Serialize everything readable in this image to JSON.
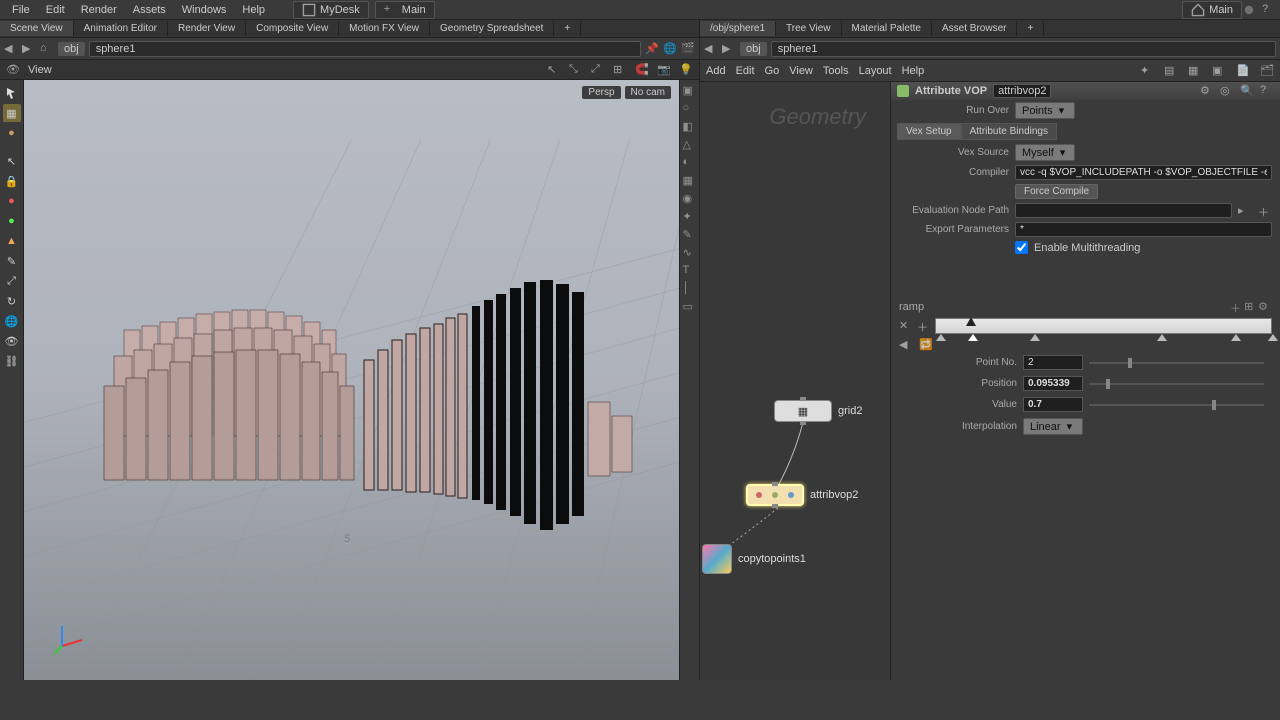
{
  "menu": {
    "items": [
      "File",
      "Edit",
      "Render",
      "Assets",
      "Windows",
      "Help"
    ],
    "desk": "MyDesk",
    "main": "Main",
    "right_main": "Main"
  },
  "left_tabs": [
    "Scene View",
    "Animation Editor",
    "Render View",
    "Composite View",
    "Motion FX View",
    "Geometry Spreadsheet",
    "+"
  ],
  "right_tabs": [
    "/obj/sphere1",
    "Tree View",
    "Material Palette",
    "Asset Browser",
    "+"
  ],
  "path": {
    "left_crumbs": [
      "obj",
      "sphere1"
    ],
    "right_crumbs": [
      "obj",
      "sphere1"
    ]
  },
  "view": {
    "label": "View",
    "cam": [
      "Persp",
      "No cam"
    ]
  },
  "network_menu": [
    "Add",
    "Edit",
    "Go",
    "View",
    "Tools",
    "Layout",
    "Help"
  ],
  "geo_label": "Geometry",
  "nodes": {
    "grid2": {
      "label": "grid2"
    },
    "attribvop2": {
      "label": "attribvop2"
    },
    "copytopoints1": {
      "label": "copytopoints1"
    }
  },
  "params": {
    "type": "Attribute VOP",
    "name": "attribvop2",
    "run_over_label": "Run Over",
    "run_over_value": "Points",
    "tabs": [
      "Vex Setup",
      "Attribute Bindings"
    ],
    "vex_source_label": "Vex Source",
    "vex_source_value": "Myself",
    "compiler_label": "Compiler",
    "compiler_value": "vcc -q $VOP_INCLUDEPATH -o $VOP_OBJECTFILE -e $VOP_ERRORF",
    "force_compile": "Force Compile",
    "eval_path_label": "Evaluation Node Path",
    "eval_path_value": "",
    "export_label": "Export Parameters",
    "export_value": "*",
    "multithreading": "Enable Multithreading",
    "ramp_label": "ramp",
    "point_no_label": "Point No.",
    "point_no_value": "2",
    "position_label": "Position",
    "position_value": "0.095339",
    "value_label": "Value",
    "value_value": "0.7",
    "interp_label": "Interpolation",
    "interp_value": "Linear"
  }
}
